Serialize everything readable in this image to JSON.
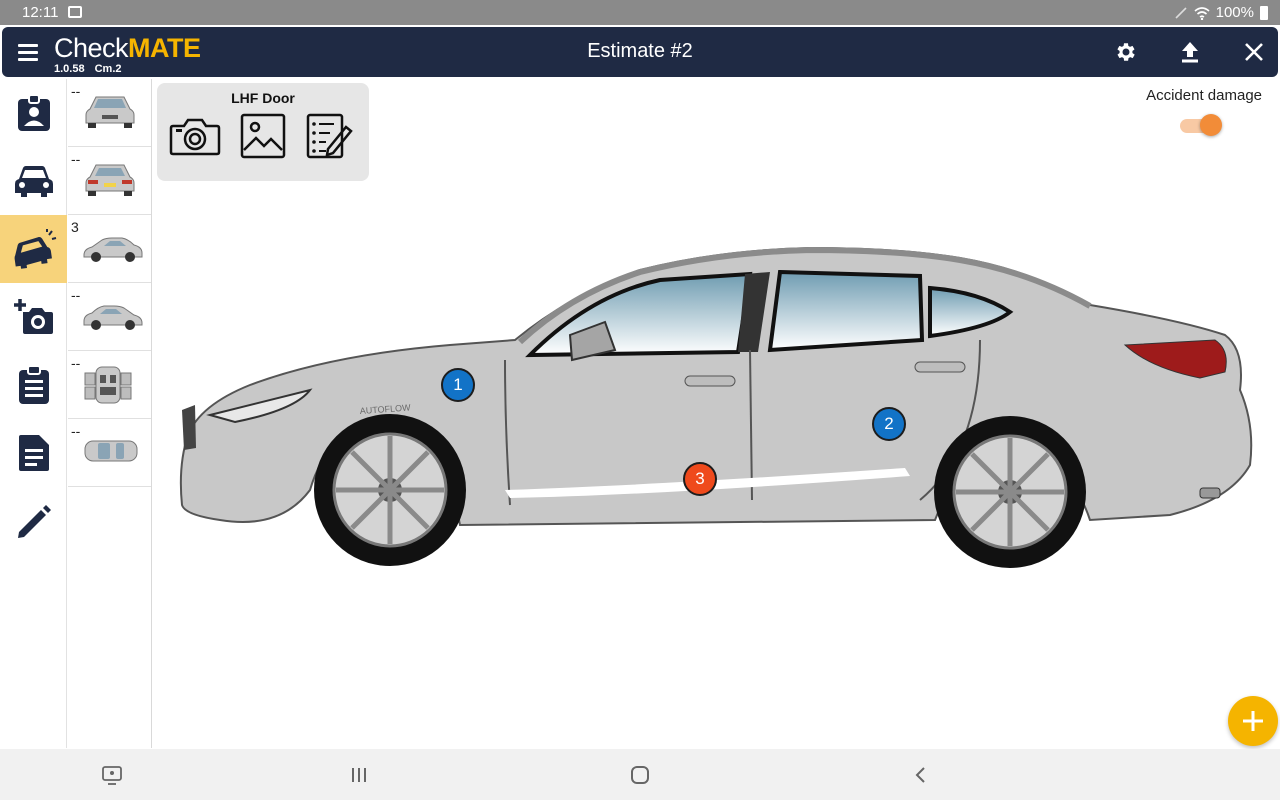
{
  "status_bar": {
    "time": "12:11",
    "battery": "100%"
  },
  "app": {
    "brand_check": "Check",
    "brand_mate": "MATE",
    "version": "1.0.58",
    "build": "Cm.2",
    "title": "Estimate #2",
    "colors": {
      "bar": "#1f2a44",
      "accent": "#f5b400"
    }
  },
  "rail": {
    "items": [
      {
        "icon": "contact-badge-icon"
      },
      {
        "icon": "car-front-icon"
      },
      {
        "icon": "car-damage-icon",
        "active": true
      },
      {
        "icon": "add-photo-icon"
      },
      {
        "icon": "clipboard-list-icon"
      },
      {
        "icon": "document-icon"
      },
      {
        "icon": "pencil-icon"
      }
    ]
  },
  "thumbnails": [
    {
      "count": "--",
      "view": "front"
    },
    {
      "count": "--",
      "view": "rear"
    },
    {
      "count": "3",
      "view": "left-side"
    },
    {
      "count": "--",
      "view": "right-side"
    },
    {
      "count": "--",
      "view": "interior"
    },
    {
      "count": "--",
      "view": "top"
    }
  ],
  "panel": {
    "title": "LHF Door"
  },
  "toggle": {
    "label": "Accident damage",
    "on": true,
    "color": "#f28c38"
  },
  "markers": [
    {
      "label": "1",
      "color": "blue"
    },
    {
      "label": "2",
      "color": "blue"
    },
    {
      "label": "3",
      "color": "red"
    }
  ],
  "car_watermark": "AUTOFLOW"
}
